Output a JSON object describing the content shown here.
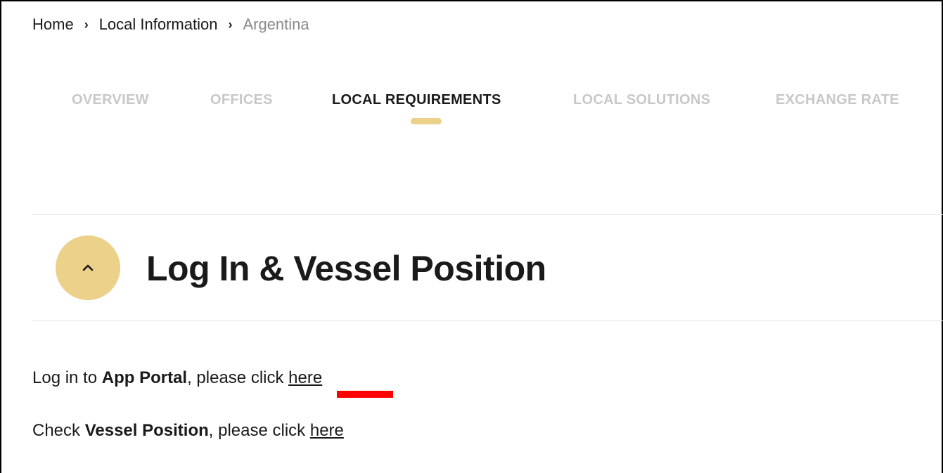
{
  "breadcrumb": {
    "items": [
      "Home",
      "Local Information"
    ],
    "current": "Argentina",
    "separator": "›"
  },
  "tabs": [
    {
      "label": "OVERVIEW",
      "active": false
    },
    {
      "label": "OFFICES",
      "active": false
    },
    {
      "label": "LOCAL REQUIREMENTS",
      "active": true
    },
    {
      "label": "LOCAL SOLUTIONS",
      "active": false
    },
    {
      "label": "EXCHANGE RATE",
      "active": false
    }
  ],
  "section": {
    "title": "Log In & Vessel Position",
    "toggle_icon": "chevron-up-icon"
  },
  "content": {
    "line1": {
      "prefix": "Log in to ",
      "bold": "App Portal",
      "middle": ", please click ",
      "link": "here"
    },
    "line2": {
      "prefix": "Check ",
      "bold": "Vessel Position",
      "middle": ", please click ",
      "link": "here"
    }
  },
  "colors": {
    "accent": "#ecd18a",
    "text": "#1a1a1a",
    "muted_tab": "#c8c8c8",
    "annotation": "#ff0000"
  }
}
